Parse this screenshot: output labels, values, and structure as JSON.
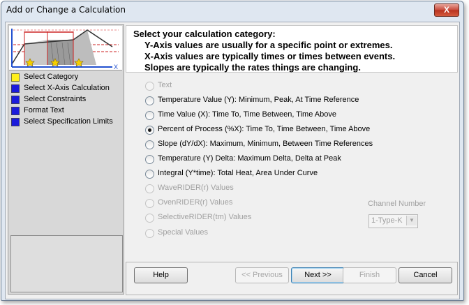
{
  "window": {
    "title": "Add or Change a Calculation",
    "close_label": "X"
  },
  "steps": [
    {
      "label": "Select Category",
      "active": true
    },
    {
      "label": "Select X-Axis Calculation",
      "active": false
    },
    {
      "label": "Select Constraints",
      "active": false
    },
    {
      "label": "Format Text",
      "active": false
    },
    {
      "label": "Select Specification Limits",
      "active": false
    }
  ],
  "thumbnail": {
    "axis_label": "X"
  },
  "header": {
    "title": "Select your calculation category:",
    "lines": [
      "Y-Axis values are usually for a specific point or extremes.",
      "X-Axis values are typically times or times between events.",
      "Slopes are typically the rates things are changing."
    ]
  },
  "options": [
    {
      "label": "Text",
      "checked": false,
      "enabled": false
    },
    {
      "label": "Temperature Value (Y):  Minimum, Peak, At Time Reference",
      "checked": false,
      "enabled": true
    },
    {
      "label": "Time Value (X):  Time To, Time Between, Time Above",
      "checked": false,
      "enabled": true
    },
    {
      "label": "Percent of Process (%X):  Time To, Time Between, Time Above",
      "checked": true,
      "enabled": true
    },
    {
      "label": "Slope (dY/dX):  Maximum, Minimum, Between Time References",
      "checked": false,
      "enabled": true
    },
    {
      "label": "Temperature (Y) Delta:  Maximum Delta, Delta at Peak",
      "checked": false,
      "enabled": true
    },
    {
      "label": "Integral (Y*time): Total Heat, Area Under Curve",
      "checked": false,
      "enabled": true
    },
    {
      "label": "WaveRIDER(r) Values",
      "checked": false,
      "enabled": false
    },
    {
      "label": "OvenRIDER(r) Values",
      "checked": false,
      "enabled": false
    },
    {
      "label": "SelectiveRIDER(tm) Values",
      "checked": false,
      "enabled": false
    },
    {
      "label": "Special  Values",
      "checked": false,
      "enabled": false
    }
  ],
  "channel": {
    "label": "Channel Number",
    "value": "1-Type-K"
  },
  "buttons": {
    "help": "Help",
    "previous": "<< Previous",
    "next": "Next >>",
    "finish": "Finish",
    "cancel": "Cancel"
  }
}
